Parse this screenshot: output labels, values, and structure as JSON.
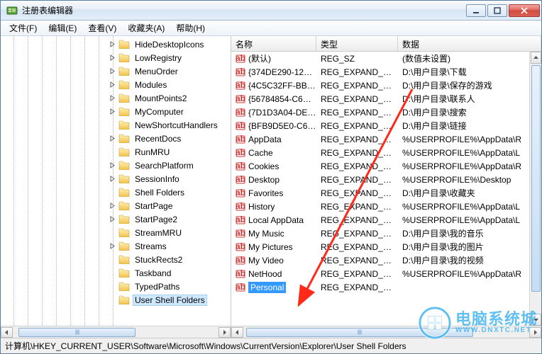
{
  "window": {
    "title": "注册表编辑器"
  },
  "menu": {
    "file": "文件(F)",
    "edit": "编辑(E)",
    "view": "查看(V)",
    "favorites": "收藏夹(A)",
    "help": "帮助(H)"
  },
  "tree": {
    "items": [
      {
        "label": "HideDesktopIcons",
        "expandable": true
      },
      {
        "label": "LowRegistry",
        "expandable": true
      },
      {
        "label": "MenuOrder",
        "expandable": true
      },
      {
        "label": "Modules",
        "expandable": true
      },
      {
        "label": "MountPoints2",
        "expandable": true
      },
      {
        "label": "MyComputer",
        "expandable": true
      },
      {
        "label": "NewShortcutHandlers",
        "expandable": false
      },
      {
        "label": "RecentDocs",
        "expandable": true
      },
      {
        "label": "RunMRU",
        "expandable": false
      },
      {
        "label": "SearchPlatform",
        "expandable": true
      },
      {
        "label": "SessionInfo",
        "expandable": true
      },
      {
        "label": "Shell Folders",
        "expandable": false
      },
      {
        "label": "StartPage",
        "expandable": true
      },
      {
        "label": "StartPage2",
        "expandable": true
      },
      {
        "label": "StreamMRU",
        "expandable": false
      },
      {
        "label": "Streams",
        "expandable": true
      },
      {
        "label": "StuckRects2",
        "expandable": false
      },
      {
        "label": "Taskband",
        "expandable": false
      },
      {
        "label": "TypedPaths",
        "expandable": false
      },
      {
        "label": "User Shell Folders",
        "expandable": false,
        "selected": true
      }
    ]
  },
  "columns": {
    "name": "名称",
    "type": "类型",
    "data": "数据"
  },
  "values": [
    {
      "name": "(默认)",
      "type": "REG_SZ",
      "data": "(数值未设置)"
    },
    {
      "name": "{374DE290-12…",
      "type": "REG_EXPAND_SZ",
      "data": "D:\\用户目录\\下载"
    },
    {
      "name": "{4C5C32FF-BB…",
      "type": "REG_EXPAND_SZ",
      "data": "D:\\用户目录\\保存的游戏"
    },
    {
      "name": "{56784854-C6…",
      "type": "REG_EXPAND_SZ",
      "data": "D:\\用户目录\\联系人"
    },
    {
      "name": "{7D1D3A04-DE…",
      "type": "REG_EXPAND_SZ",
      "data": "D:\\用户目录\\搜索"
    },
    {
      "name": "{BFB9D5E0-C6…",
      "type": "REG_EXPAND_SZ",
      "data": "D:\\用户目录\\链接"
    },
    {
      "name": "AppData",
      "type": "REG_EXPAND_SZ",
      "data": "%USERPROFILE%\\AppData\\R"
    },
    {
      "name": "Cache",
      "type": "REG_EXPAND_SZ",
      "data": "%USERPROFILE%\\AppData\\L"
    },
    {
      "name": "Cookies",
      "type": "REG_EXPAND_SZ",
      "data": "%USERPROFILE%\\AppData\\R"
    },
    {
      "name": "Desktop",
      "type": "REG_EXPAND_SZ",
      "data": "%USERPROFILE%\\Desktop"
    },
    {
      "name": "Favorites",
      "type": "REG_EXPAND_SZ",
      "data": "D:\\用户目录\\收藏夹"
    },
    {
      "name": "History",
      "type": "REG_EXPAND_SZ",
      "data": "%USERPROFILE%\\AppData\\L"
    },
    {
      "name": "Local AppData",
      "type": "REG_EXPAND_SZ",
      "data": "%USERPROFILE%\\AppData\\L"
    },
    {
      "name": "My Music",
      "type": "REG_EXPAND_SZ",
      "data": "D:\\用户目录\\我的音乐"
    },
    {
      "name": "My Pictures",
      "type": "REG_EXPAND_SZ",
      "data": "D:\\用户目录\\我的图片"
    },
    {
      "name": "My Video",
      "type": "REG_EXPAND_SZ",
      "data": "D:\\用户目录\\我的视频"
    },
    {
      "name": "NetHood",
      "type": "REG_EXPAND_SZ",
      "data": "%USERPROFILE%\\AppData\\R"
    },
    {
      "name": "Personal",
      "type": "REG_EXPAND_SZ",
      "data": "",
      "selected": true
    }
  ],
  "statusbar": {
    "path": "计算机\\HKEY_CURRENT_USER\\Software\\Microsoft\\Windows\\CurrentVersion\\Explorer\\User Shell Folders"
  },
  "watermark": {
    "cn": "电脑系统城",
    "en": "WWW.DNXTC.NET"
  }
}
